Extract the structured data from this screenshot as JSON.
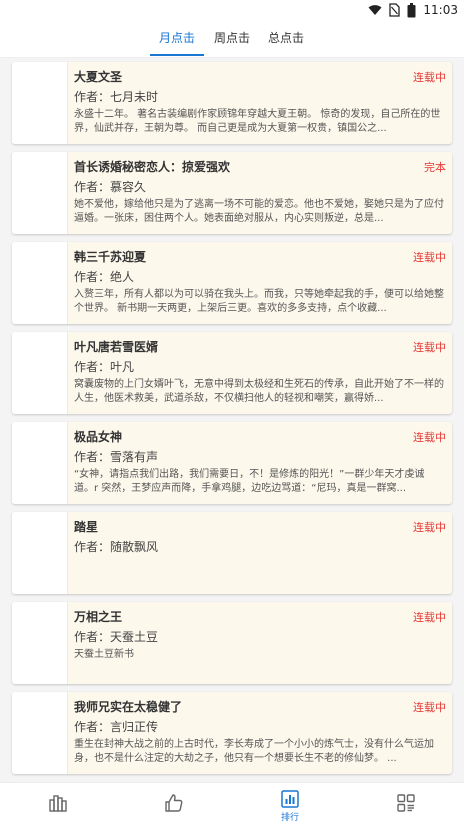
{
  "status_bar": {
    "time": "11:03",
    "icons": [
      "wifi-icon",
      "sim-no-signal-icon",
      "battery-icon"
    ]
  },
  "tabs": [
    {
      "label": "月点击",
      "active": true
    },
    {
      "label": "周点击",
      "active": false
    },
    {
      "label": "总点击",
      "active": false
    }
  ],
  "books": [
    {
      "title": "大夏文圣",
      "status": "连载中",
      "author": "作者：七月未时",
      "desc": "永盛十二年。 著名古装编剧作家顾锦年穿越大夏王朝。 惊奇的发现，自己所在的世界，仙武并存，王朝为尊。 而自己更是成为大夏第一权贵，镇国公之..."
    },
    {
      "title": "首长诱婚秘密恋人：掠爱强欢",
      "status": "完本",
      "author": "作者：慕容久",
      "desc": "她不爱他，嫁给他只是为了逃离一场不可能的爱恋。他也不爱她，娶她只是为了应付逼婚。一张床，困住两个人。她表面绝对服从，内心实则叛逆，总是..."
    },
    {
      "title": "韩三千苏迎夏",
      "status": "连载中",
      "author": "作者：绝人",
      "desc": "入赘三年，所有人都以为可以骑在我头上。而我，只等她牵起我的手，便可以给她整个世界。 新书期一天两更，上架后三更。喜欢的多多支持，点个收藏..."
    },
    {
      "title": "叶凡唐若雪医婿",
      "status": "连载中",
      "author": "作者：叶凡",
      "desc": "窝囊废物的上门女婿叶飞，无意中得到太极经和生死石的传承，自此开始了不一样的人生，他医术救美，武道杀敌，不仅横扫他人的轻视和嘲笑，赢得娇..."
    },
    {
      "title": "极品女神",
      "status": "连载中",
      "author": "作者：雪落有声",
      "desc": "“女神，请指点我们出路，我们需要日，不！是修炼的阳光！”一群少年天才虔诚道。r 突然，王梦应声而降，手拿鸡腿，边吃边骂道：“尼玛，真是一群窝..."
    },
    {
      "title": "踏星",
      "status": "连载中",
      "author": "作者：随散飘风",
      "desc": ""
    },
    {
      "title": "万相之王",
      "status": "连载中",
      "author": "作者：天蚕土豆",
      "desc": "天蚕土豆新书"
    },
    {
      "title": "我师兄实在太稳健了",
      "status": "连载中",
      "author": "作者：言归正传",
      "desc": "重生在封神大战之前的上古时代，李长寿成了一个小小的炼气士，没有什么气运加身，也不是什么注定的大劫之子，他只有一个想要长生不老的修仙梦。 ..."
    }
  ],
  "bottom_nav": [
    {
      "icon": "bookshelf-icon",
      "label": "",
      "active": false
    },
    {
      "icon": "thumbs-up-icon",
      "label": "",
      "active": false
    },
    {
      "icon": "bar-chart-icon",
      "label": "排行",
      "active": true
    },
    {
      "icon": "category-grid-icon",
      "label": "",
      "active": false
    }
  ],
  "colors": {
    "accent": "#1976d2",
    "status_red": "#e53935",
    "card_bg": "#fdf8ec"
  }
}
